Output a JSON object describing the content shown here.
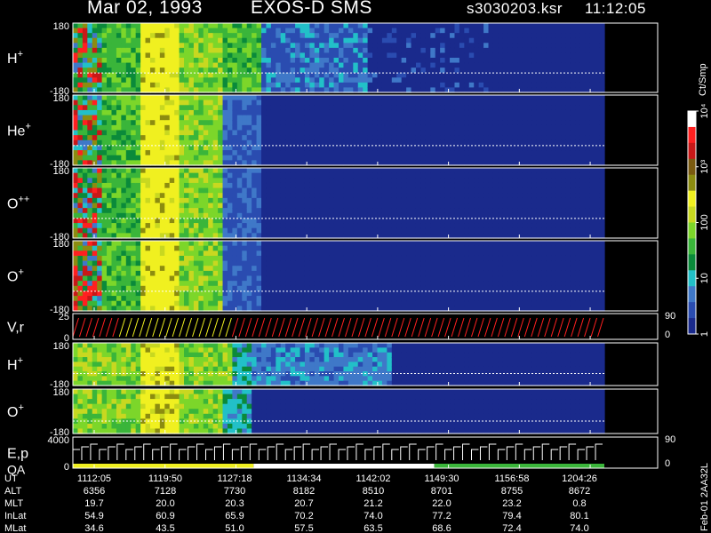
{
  "header": {
    "date": "Mar 02, 1993",
    "instrument": "EXOS-D SMS",
    "file": "s3030203.ksr",
    "time": "11:12:05"
  },
  "colorbar": {
    "unit": "Ct/Smp",
    "ticks": [
      {
        "label": "1",
        "value": 1
      },
      {
        "label": "10",
        "value": 10
      },
      {
        "label": "100",
        "value": 100
      },
      {
        "label": "10³",
        "value": 1000
      },
      {
        "label": "10⁴",
        "value": 10000
      }
    ]
  },
  "footer_id": "Feb-01 2AA32L",
  "chart_data": {
    "type": "heatmap",
    "panels": [
      {
        "key": "h1",
        "label_base": "H",
        "label_sup": "+",
        "ymin_label": "-180",
        "ymax_label": "180"
      },
      {
        "key": "he",
        "label_base": "He",
        "label_sup": "+",
        "ymin_label": "-180",
        "ymax_label": "180"
      },
      {
        "key": "opp",
        "label_base": "O",
        "label_sup": "++",
        "ymin_label": "-180",
        "ymax_label": "180"
      },
      {
        "key": "o1",
        "label_base": "O",
        "label_sup": "+",
        "ymin_label": "-180",
        "ymax_label": "180"
      },
      {
        "key": "vr",
        "label_base": "V,r",
        "label_sup": "",
        "ymin_label": "0",
        "ymax_label": "25",
        "right_top": "90",
        "right_bottom": "0"
      },
      {
        "key": "h2",
        "label_base": "H",
        "label_sup": "+",
        "ymin_label": "-180",
        "ymax_label": "180"
      },
      {
        "key": "o2",
        "label_base": "O",
        "label_sup": "+",
        "ymin_label": "-180",
        "ymax_label": "180"
      },
      {
        "key": "ep",
        "label_base": "E,p",
        "label_sup": "",
        "label2": "QA",
        "ymin_label": "0",
        "ymax_label": "4000",
        "right_top": "90",
        "right_bottom": "0"
      }
    ],
    "time_table": {
      "row_labels": [
        "UT",
        "ALT",
        "MLT",
        "InLat",
        "MLat"
      ],
      "UT": [
        "1112:05",
        "1119:50",
        "1127:18",
        "1134:34",
        "1142:02",
        "1149:30",
        "1156:58",
        "1204:26"
      ],
      "ALT": [
        "6356",
        "7128",
        "7730",
        "8182",
        "8510",
        "8701",
        "8755",
        "8672"
      ],
      "MLT": [
        "19.7",
        "20.0",
        "20.3",
        "20.7",
        "21.2",
        "22.0",
        "23.2",
        "0.8"
      ],
      "InLat": [
        "54.9",
        "60.9",
        "65.9",
        "70.2",
        "74.0",
        "77.2",
        "79.4",
        "80.1"
      ],
      "MLat": [
        "34.6",
        "43.5",
        "51.0",
        "57.5",
        "63.5",
        "68.6",
        "72.4",
        "74.0"
      ]
    }
  }
}
